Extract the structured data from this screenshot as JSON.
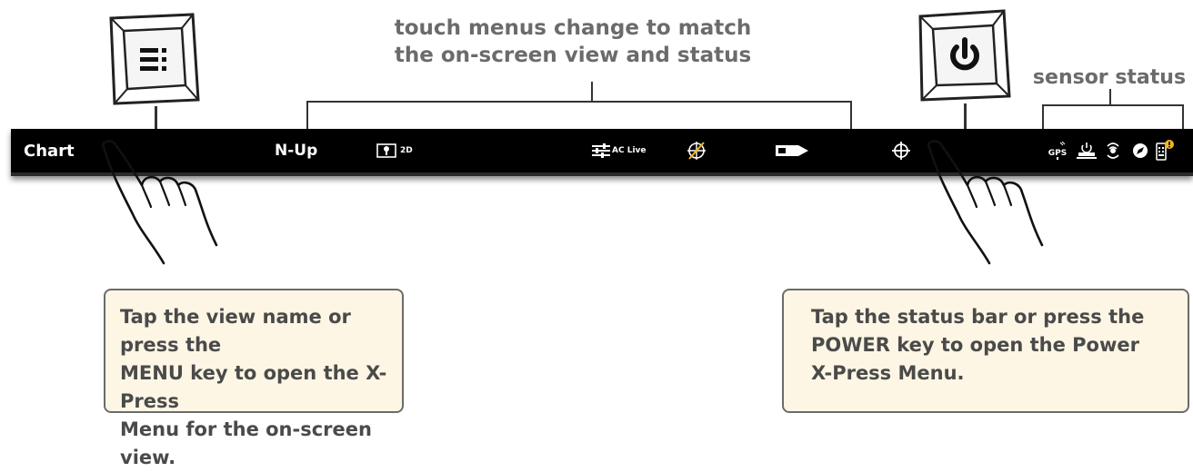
{
  "annotations": {
    "touch_menus_caption": "touch menus change to match\nthe on-screen view and status",
    "sensor_status_caption": "sensor status"
  },
  "statusbar": {
    "view_name": "Chart",
    "orientation": "N-Up",
    "chart_mode_label": "2D",
    "autochart_label": "AC Live",
    "icons": [
      "chart-mode-icon",
      "autochart-live-icon",
      "no-radar-icon",
      "vessel-icon",
      "cursor-crosshair-icon"
    ],
    "sensor_icons": [
      "gps-icon",
      "power-status-icon",
      "sonar-icon",
      "compass-icon",
      "battery-alert-icon"
    ],
    "gps_label": "GPS"
  },
  "keys": {
    "menu_key_icon": "menu-lines-icon",
    "power_key_icon": "power-icon"
  },
  "callouts": {
    "left": "Tap the view name or press the\nMENU key to open the X-Press\nMenu for the on-screen view.",
    "right": "Tap the status bar or press the\nPOWER key to open the Power\nX-Press Menu."
  },
  "colors": {
    "statusbar": "#000000",
    "callout_bg": "#fdf6e4",
    "caption_text": "#6b6b6b",
    "alert": "#f2b51d"
  }
}
